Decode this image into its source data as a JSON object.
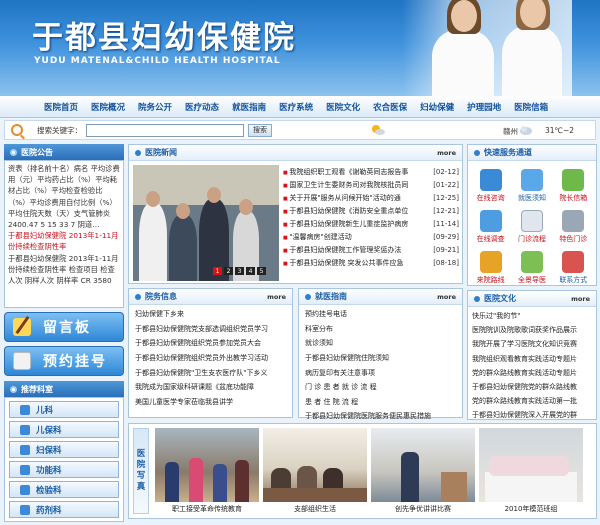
{
  "header": {
    "title_cn": "于都县妇幼保健院",
    "title_en": "YUDU MATENAL&CHILD   HEALTH HOSPITAL"
  },
  "nav": [
    "医院首页",
    "医院概况",
    "院务公开",
    "医疗动态",
    "就医指南",
    "医疗系统",
    "医院文化",
    "农合医保",
    "妇幼保健",
    "护理园地",
    "医院信箱"
  ],
  "search": {
    "label": "搜索关键字：",
    "value": "",
    "button": "搜索",
    "city": "赣州",
    "temp": "31℃~2"
  },
  "notice": {
    "title": "医院公告",
    "text1": "资表（排名前十名）病名 平均诊费用（元）平均药占比（%）平均耗材占比（%）平均检查检验比（%）平均诊费用自付比例（%）平均住院天数（天）支气管肺炎 2400.47 5 15 33 7 阴道…",
    "text2": "于都县妇幼保健院 2013年1-11月份持续检查阴性率",
    "text3": "于都县妇幼保健院 2013年1-11月份持续检查阴性率 检查项目 检查人次 阴样人次 阴样率 CR 3580"
  },
  "buttons": {
    "message": "留言板",
    "booking": "预约挂号"
  },
  "depts": {
    "title": "推荐科室",
    "items": [
      "儿科",
      "儿保科",
      "妇保科",
      "功能科",
      "检验科",
      "药剂科"
    ]
  },
  "news": {
    "title": "医院新闻",
    "more": "more",
    "pages": [
      "1",
      "2",
      "3",
      "4",
      "5"
    ],
    "items": [
      {
        "t": "我院组织职工观看《谢勒英同志报告事",
        "d": "[02-12]"
      },
      {
        "t": "国家卫生计生委财务司对我院核批员同",
        "d": "[01-22]"
      },
      {
        "t": "关于开展\"服务从问候开始\"活动的通",
        "d": "[12-25]"
      },
      {
        "t": "于都县妇幼保健院《消防安全重点单位",
        "d": "[12-21]"
      },
      {
        "t": "于都县妇幼保健院新生儿重症监护病房",
        "d": "[11-14]"
      },
      {
        "t": "\"温馨病房\"创建活动",
        "d": "[09-29]"
      },
      {
        "t": "于都县妇幼保健院工作管理奖惩办法",
        "d": "[09-21]"
      },
      {
        "t": "于都县妇幼保健院 突发公共事件应急",
        "d": "[08-18]"
      }
    ]
  },
  "affairs": {
    "title": "院务信息",
    "more": "more",
    "items": [
      "妇幼保健下乡来",
      "于都县妇幼保健院党支部选调组织党员学习",
      "于都县妇幼保健院组织党员参加党员大会",
      "于都县妇幼保健院组织党员外出教学习活动",
      "于都县妇幼保健院\"卫生支农医疗队\"下乡义",
      "我院成为国家级科研课题《盆底功能障",
      "美国儿童医学专家莅临我县讲学"
    ]
  },
  "guide": {
    "title": "就医指南",
    "more": "more",
    "items": [
      "预约挂号电话",
      "科室分布",
      "就诊须知",
      "于都县妇幼保健院住院须知",
      "病历复印有关注意事项",
      "门 诊 患 者 就 诊 流 程",
      "患 者 住 院 流 程",
      "于都县妇幼保健院医院服务便民惠民措施"
    ]
  },
  "quick": {
    "title": "快速服务通道",
    "items": [
      "在线咨询",
      "就医须知",
      "院长信箱",
      "在线调查",
      "门诊流程",
      "特色门诊",
      "来院路线",
      "全景导医",
      "联系方式"
    ]
  },
  "culture": {
    "title": "医院文化",
    "more": "more",
    "items": [
      "快乐过\"我的节\"",
      "医院院训及院歌歌词获奖作品展示",
      "我院开展了学习医院文化知识竞赛",
      "我院组织观看教育实践活动专题片",
      "党的群众路线教育实践活动专题片",
      "于都县妇幼保健院党的群众路线教",
      "党的群众路线教育实践活动第一批",
      "于都县妇幼保健院深入开展党的群"
    ]
  },
  "gallery": {
    "side": [
      "医",
      "院",
      "写",
      "真"
    ],
    "items": [
      "职工接受革命传统教育",
      "支部组织生活",
      "创先争优讲讲比赛",
      "2010年模范班组"
    ]
  }
}
